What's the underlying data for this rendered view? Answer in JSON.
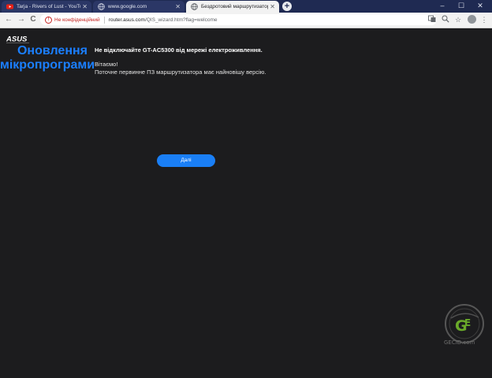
{
  "browser": {
    "tabs": [
      {
        "title": "Tarja - Rivers of Lust - YouTube",
        "icon": "youtube-icon",
        "active": false
      },
      {
        "title": "www.google.com",
        "icon": "globe-icon",
        "active": false
      },
      {
        "title": "Бездротовий маршрутизатор AS",
        "icon": "globe-icon",
        "active": true
      }
    ],
    "new_tab": "+",
    "window_controls": {
      "minimize": "–",
      "maximize": "☐",
      "close": "✕"
    },
    "nav": {
      "back": "←",
      "forward": "→",
      "reload": "C"
    },
    "address": {
      "security_text": "Не конфіденційний",
      "host": "router.asus.com",
      "path": "/QIS_wizard.htm?flag=welcome"
    },
    "toolbar_icons": [
      "translate-icon",
      "zoom-icon",
      "bookmark-star-icon",
      "account-icon",
      "menu-icon"
    ]
  },
  "page": {
    "logo_text": "ASUS",
    "title_line1": "Оновлення",
    "title_line2": "мікропрограми",
    "warning": "Не відключайте GT-AC5300 від мережі електроживлення.",
    "message_line1": "Вітаємо!",
    "message_line2": "Поточне первинне ПЗ маршрутизатора має найновішу версію.",
    "next_button": "Далі"
  },
  "watermark": {
    "text": "GECID.com"
  },
  "colors": {
    "accent": "#1b7fff",
    "button": "#1a7ff6",
    "background": "#1c1c1e",
    "tabbar": "#1f2a52",
    "insecure": "#c5221f"
  }
}
